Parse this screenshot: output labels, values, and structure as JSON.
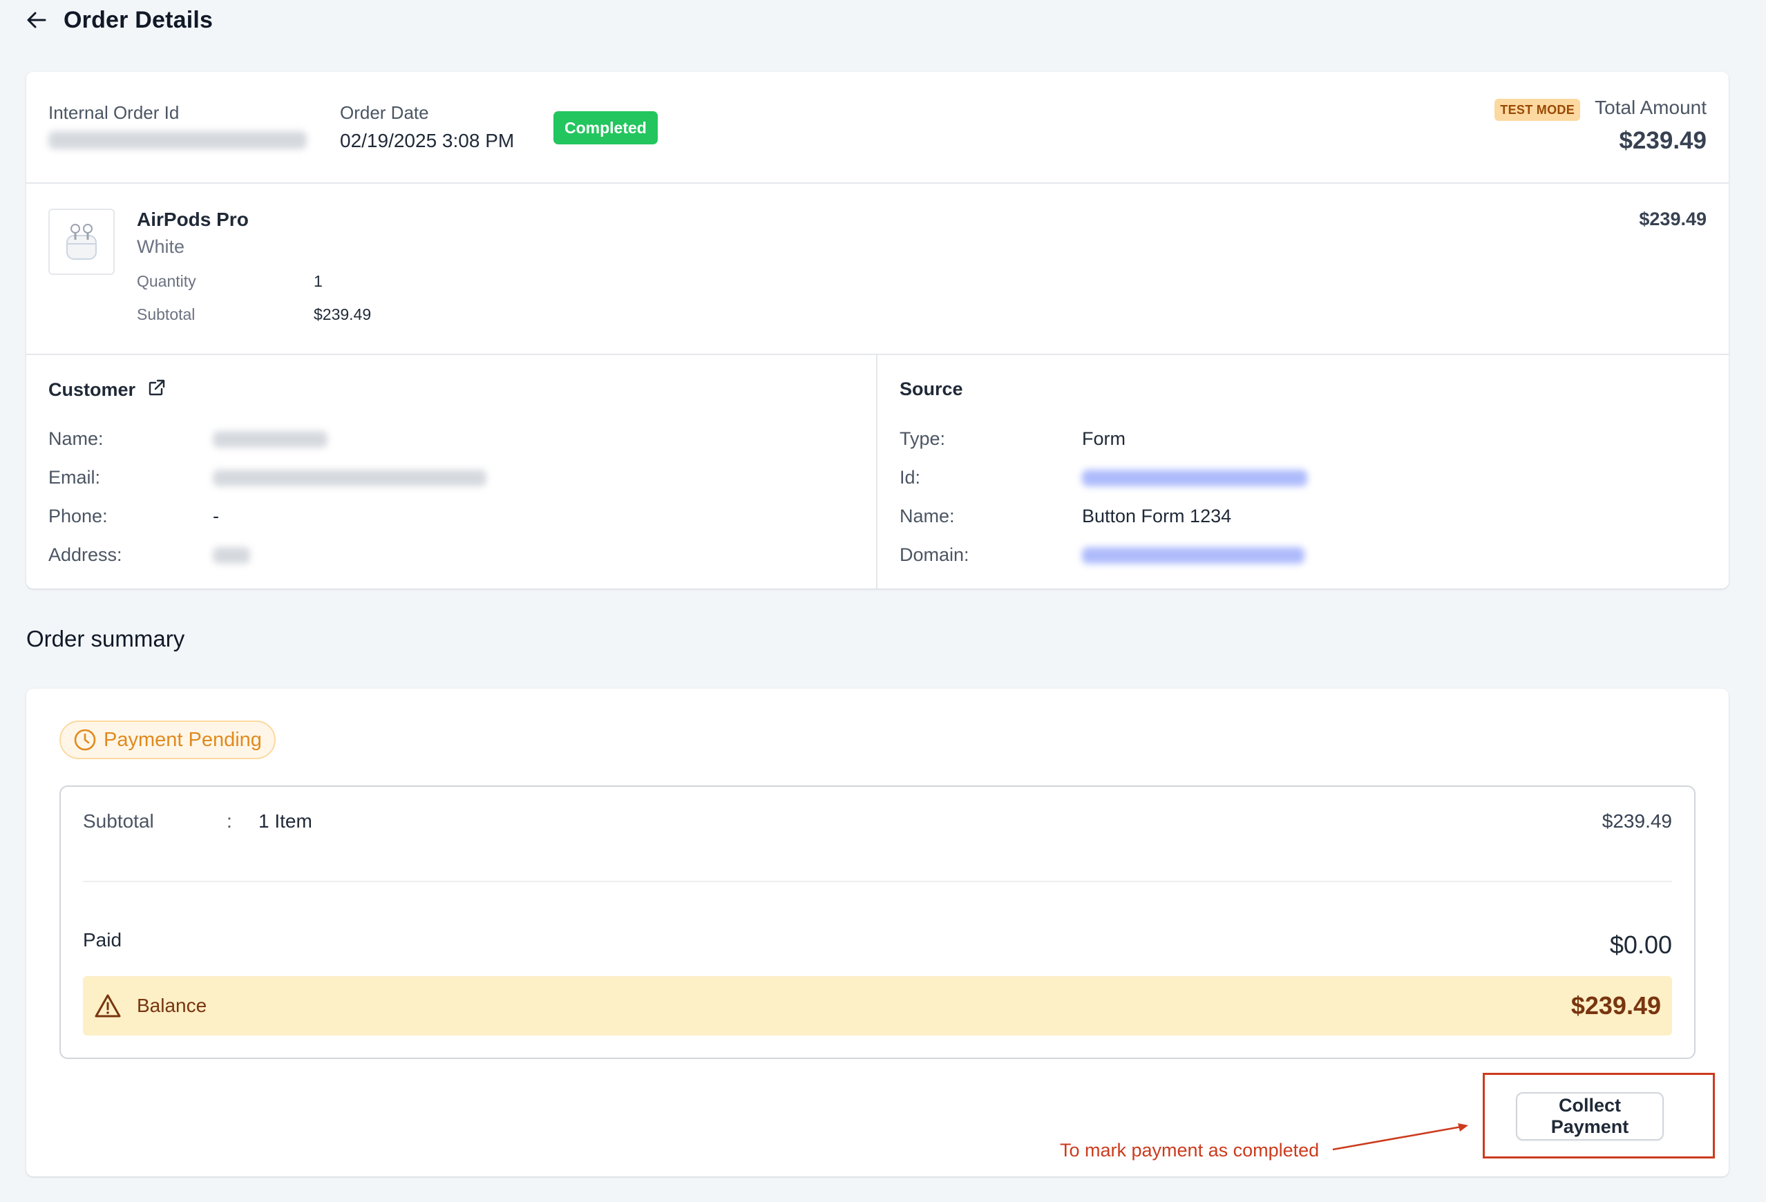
{
  "header": {
    "title": "Order Details"
  },
  "order": {
    "internal_id_label": "Internal Order Id",
    "date_label": "Order Date",
    "date_value": "02/19/2025 3:08 PM",
    "status": "Completed",
    "test_mode": "TEST MODE",
    "total_label": "Total Amount",
    "total_value": "$239.49"
  },
  "product": {
    "name": "AirPods Pro",
    "variant": "White",
    "price": "$239.49",
    "quantity_label": "Quantity",
    "quantity_value": "1",
    "subtotal_label": "Subtotal",
    "subtotal_value": "$239.49"
  },
  "customer": {
    "heading": "Customer",
    "name_label": "Name:",
    "email_label": "Email:",
    "phone_label": "Phone:",
    "phone_value": "-",
    "address_label": "Address:"
  },
  "source": {
    "heading": "Source",
    "type_label": "Type:",
    "type_value": "Form",
    "id_label": "Id:",
    "name_label": "Name:",
    "name_value": "Button Form 1234",
    "domain_label": "Domain:"
  },
  "summary": {
    "title": "Order summary",
    "payment_status": "Payment Pending",
    "subtotal_label": "Subtotal",
    "colon": ":",
    "items": "1 Item",
    "subtotal_value": "$239.49",
    "paid_label": "Paid",
    "paid_value": "$0.00",
    "balance_label": "Balance",
    "balance_value": "$239.49",
    "collect_button": "Collect Payment"
  },
  "annotation": {
    "text": "To mark payment as completed"
  },
  "colors": {
    "status_green": "#22c55e",
    "pending_orange": "#e08a1e",
    "balance_bg": "#fdefc6",
    "annotation_red": "#cc3b1d"
  }
}
